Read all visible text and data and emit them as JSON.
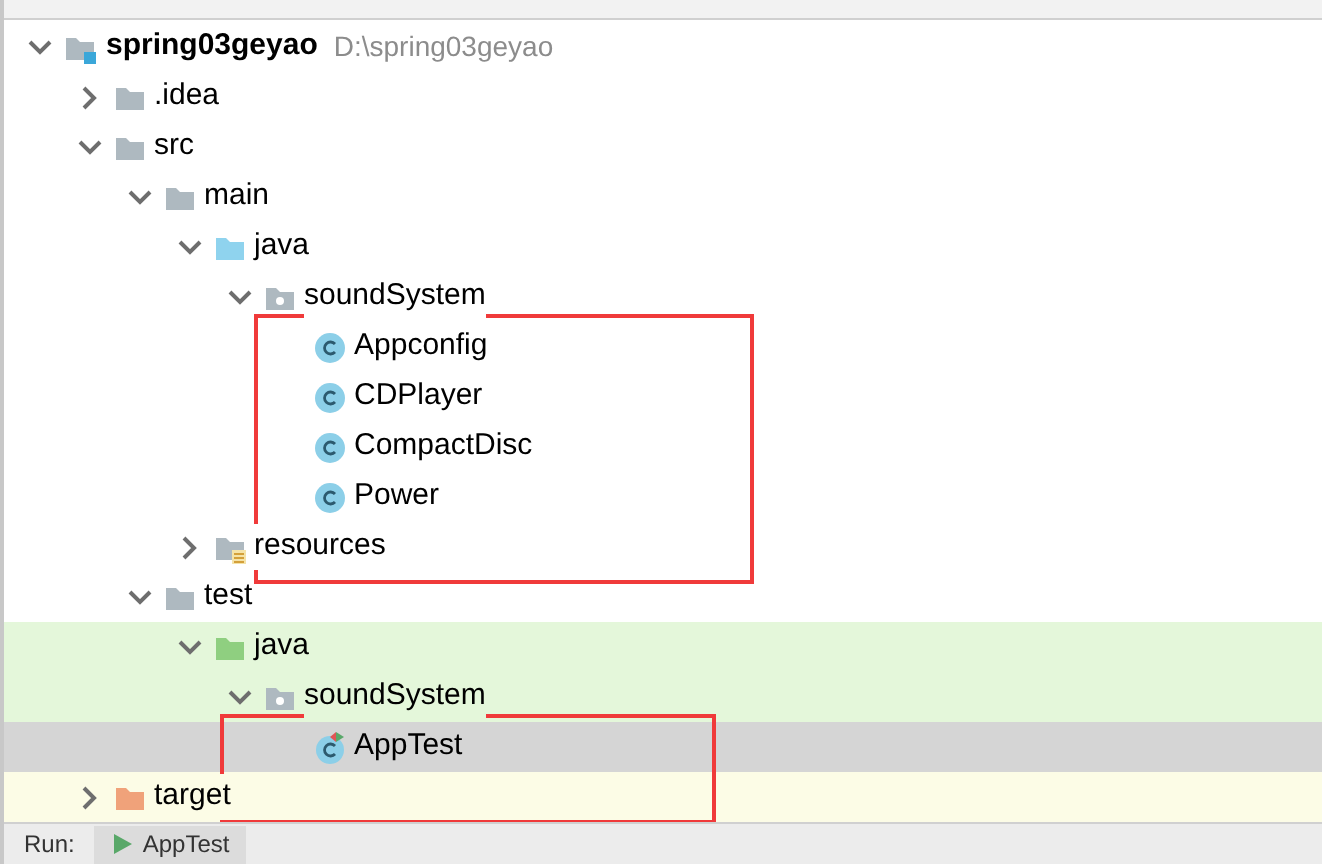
{
  "project_tree": [
    {
      "label": "spring03geyao",
      "path": "D:\\spring03geyao",
      "kind": "project",
      "expanded": true,
      "selected": false,
      "children": [
        {
          "label": ".idea",
          "kind": "folder",
          "expanded": false,
          "selected": false
        },
        {
          "label": "src",
          "kind": "folder",
          "expanded": true,
          "selected": false,
          "children": [
            {
              "label": "main",
              "kind": "folder",
              "expanded": true,
              "selected": false,
              "children": [
                {
                  "label": "java",
                  "kind": "source_folder",
                  "expanded": true,
                  "selected": false,
                  "children": [
                    {
                      "label": "soundSystem",
                      "kind": "package",
                      "expanded": true,
                      "selected": false,
                      "annotated": true,
                      "children": [
                        {
                          "label": "Appconfig",
                          "kind": "class",
                          "selected": false
                        },
                        {
                          "label": "CDPlayer",
                          "kind": "class",
                          "selected": false
                        },
                        {
                          "label": "CompactDisc",
                          "kind": "class",
                          "selected": false
                        },
                        {
                          "label": "Power",
                          "kind": "class",
                          "selected": false
                        }
                      ]
                    }
                  ]
                },
                {
                  "label": "resources",
                  "kind": "resources_folder",
                  "expanded": false,
                  "selected": false
                }
              ]
            },
            {
              "label": "test",
              "kind": "folder",
              "expanded": true,
              "selected": false,
              "children": [
                {
                  "label": "java",
                  "kind": "test_folder",
                  "expanded": true,
                  "selected": false,
                  "children": [
                    {
                      "label": "soundSystem",
                      "kind": "test_package",
                      "expanded": true,
                      "selected": false,
                      "annotated": true,
                      "children": [
                        {
                          "label": "AppTest",
                          "kind": "test_class",
                          "selected": true
                        }
                      ]
                    }
                  ]
                }
              ]
            }
          ]
        },
        {
          "label": "target",
          "kind": "excluded_folder",
          "expanded": false,
          "selected": false
        }
      ]
    }
  ],
  "run_bar": {
    "label": "Run:",
    "tabs": [
      {
        "label": "AppTest",
        "selected": true
      }
    ]
  }
}
